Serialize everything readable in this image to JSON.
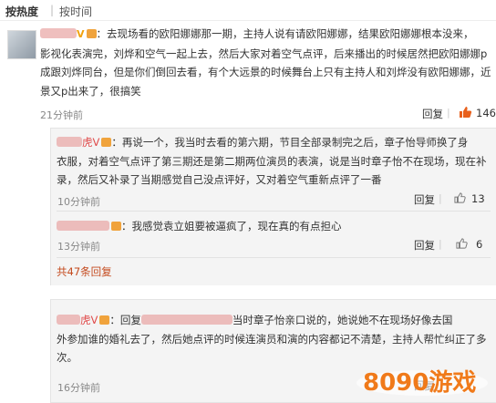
{
  "sort": {
    "hot": "按热度",
    "sep": "|",
    "time": "按时间"
  },
  "main_comment": {
    "author_suffix": "V",
    "lines": [
      "：去现场看的欧阳娜娜那一期，主持人说有请欧阳娜娜，结果欧阳娜娜根本没来，",
      "影视化表演完，刘烨和空气一起上去，然后大家对着空气点评，后来播出的时候居然把欧阳娜娜p",
      "成跟刘烨同台，但是你们倒回去看，有个大远景的时候舞台上只有主持人和刘烨没有欧阳娜娜，近",
      "景又p出来了，很搞笑"
    ],
    "time": "21分钟前",
    "reply_label": "回复",
    "likes": "146"
  },
  "replies": [
    {
      "author_suffix": "虎V",
      "lines": [
        "：再说一个，我当时去看的第六期，节目全部录制完之后，章子怡导师换了身",
        "衣服，对着空气点评了第三期还是第二期两位演员的表演，说是当时章子怡不在现场，现在补",
        "录，然后又补录了当期感觉自己没点评好，又对着空气重新点评了一番"
      ],
      "time": "10分钟前",
      "reply_label": "回复",
      "likes": "13"
    },
    {
      "author_suffix": "",
      "lines": [
        "：我感觉袁立姐要被逼疯了，现在真的有点担心"
      ],
      "time": "13分钟前",
      "reply_label": "回复",
      "likes": "6"
    }
  ],
  "more_replies": "共47条回复",
  "lower_reply": {
    "author_suffix": "虎V",
    "reply_prefix": "：回复",
    "lines_first": "当时章子怡亲口说的，她说她不在现场好像去国",
    "lines": [
      "外参加谁的婚礼去了，然后她点评的时候连演员和演的内容都记不清楚，主持人帮忙纠正了多",
      "次。"
    ],
    "time": "16分钟前",
    "reply_label": "回复"
  },
  "watermark": {
    "text": "8090游戏"
  },
  "colors": {
    "accent": "#e8601c",
    "username": "#e04a4a",
    "more": "#c44a1e"
  }
}
